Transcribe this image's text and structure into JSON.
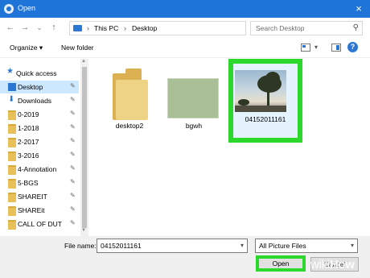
{
  "window": {
    "title": "Open",
    "close_icon": "×"
  },
  "address": {
    "crumbs": [
      "This PC",
      "Desktop"
    ],
    "search_placeholder": "Search Desktop"
  },
  "toolbar": {
    "organize": "Organize ▾",
    "new_folder": "New folder",
    "help": "?"
  },
  "sidebar": {
    "quick_access": "Quick access",
    "items": [
      {
        "label": "Desktop",
        "icon": "desktop-icon"
      },
      {
        "label": "Downloads",
        "icon": "download-icon"
      },
      {
        "label": "0-2019",
        "icon": "folder-icon"
      },
      {
        "label": "1-2018",
        "icon": "folder-icon"
      },
      {
        "label": "2-2017",
        "icon": "folder-icon"
      },
      {
        "label": "3-2016",
        "icon": "folder-icon"
      },
      {
        "label": "4-Annotation",
        "icon": "folder-icon"
      },
      {
        "label": "5-BGS",
        "icon": "folder-icon"
      },
      {
        "label": "SHAREIT",
        "icon": "folder-icon"
      },
      {
        "label": "SHAREit",
        "icon": "folder-icon"
      },
      {
        "label": "CALL OF DUT",
        "icon": "folder-icon"
      }
    ]
  },
  "files": [
    {
      "name": "desktop2",
      "type": "folder"
    },
    {
      "name": "bgwh",
      "type": "image-green"
    },
    {
      "name": "04152011161",
      "type": "image-photo",
      "selected": true
    }
  ],
  "bottom": {
    "file_name_label": "File name:",
    "file_name_value": "04152011161",
    "file_type": "All Picture Files",
    "open_label": "Open",
    "cancel_label": "Cancel"
  },
  "watermark": {
    "prefix": "wiki",
    "suffix": "How"
  },
  "colors": {
    "titlebar": "#1f74d8",
    "highlight": "#2cd82c",
    "folder": "#efd384"
  }
}
